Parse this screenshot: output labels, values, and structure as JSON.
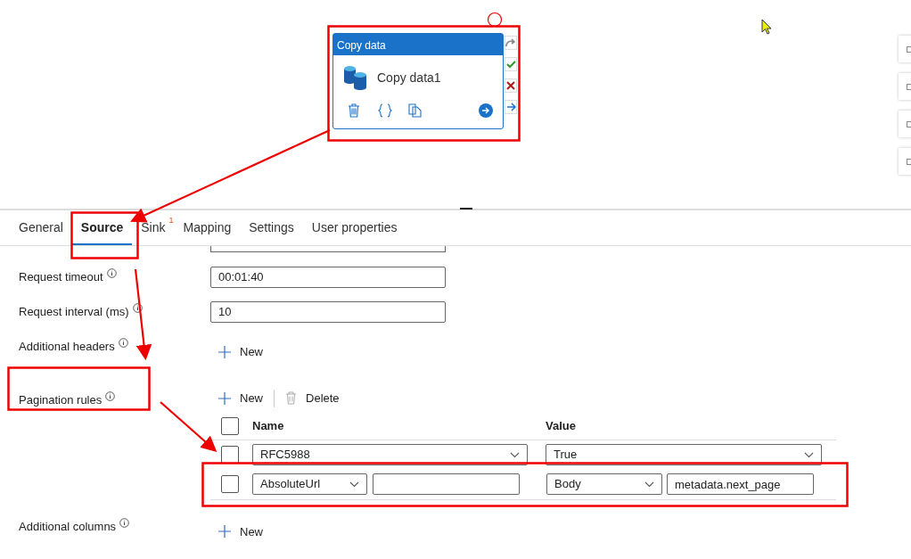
{
  "canvas": {
    "activity": {
      "header": "Copy data",
      "name": "Copy data1"
    }
  },
  "tabs": [
    {
      "label": "General",
      "selected": false
    },
    {
      "label": "Source",
      "selected": true
    },
    {
      "label": "Sink",
      "selected": false,
      "badge": "1"
    },
    {
      "label": "Mapping",
      "selected": false
    },
    {
      "label": "Settings",
      "selected": false
    },
    {
      "label": "User properties",
      "selected": false
    }
  ],
  "form": {
    "rows": [
      {
        "kind": "field",
        "label": "Request timeout",
        "value": "00:01:40"
      },
      {
        "kind": "field",
        "label": "Request interval (ms)",
        "value": "10"
      },
      {
        "kind": "new",
        "label": "Additional headers",
        "button": "New"
      },
      {
        "kind": "table",
        "label": "Pagination rules",
        "new_button": "New",
        "delete_button": "Delete",
        "columns": [
          "Name",
          "Value"
        ],
        "header_checked": false,
        "rows": [
          {
            "kind": "single",
            "checked": false,
            "name": "RFC5988",
            "value": "True"
          },
          {
            "kind": "split",
            "checked": false,
            "name": "AbsoluteUrl",
            "value_type": "Body",
            "value": "metadata.next_page"
          }
        ]
      },
      {
        "kind": "new",
        "label": "Additional columns",
        "button": "New"
      }
    ]
  }
}
